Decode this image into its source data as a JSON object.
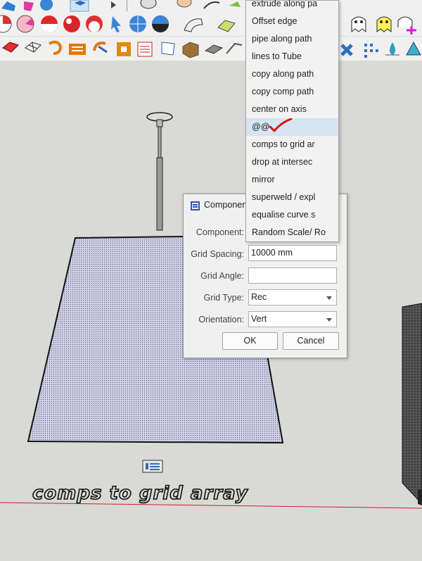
{
  "context_menu": {
    "items": [
      {
        "label": "extrude along pa"
      },
      {
        "label": "Offset edge"
      },
      {
        "label": "pipe along path"
      },
      {
        "label": "lines to Tube"
      },
      {
        "label": "copy along path"
      },
      {
        "label": "copy comp path"
      },
      {
        "label": "center on axis"
      },
      {
        "label": "@@"
      },
      {
        "label": "comps to grid ar"
      },
      {
        "label": "drop at intersec"
      },
      {
        "label": "mirror"
      },
      {
        "label": "superweld / expl"
      },
      {
        "label": "equalise curve s"
      },
      {
        "label": "Random Scale/ Ro"
      }
    ],
    "highlighted_index": 7
  },
  "dialog": {
    "title": "Componen",
    "fields": {
      "component": {
        "label": "Component:",
        "value": ""
      },
      "grid_spacing": {
        "label": "Grid Spacing:",
        "value": "10000 mm"
      },
      "grid_angle": {
        "label": "Grid Angle:",
        "value": ""
      },
      "grid_type": {
        "label": "Grid Type:",
        "value": "Rec"
      },
      "orientation": {
        "label": "Orientation:",
        "value": "Vert"
      }
    },
    "ok_label": "OK",
    "cancel_label": "Cancel"
  },
  "viewport": {
    "caption": "comps to grid array",
    "colors": {
      "background": "#d9d9d6",
      "plane_fill": "#c8c9e0",
      "red_axis": "#cc2222",
      "checkmark": "#dd1111"
    }
  },
  "toolbar": {
    "icons": [
      "ruby-plugin-icon",
      "speech-bubble-icon",
      "sphere-icon",
      "cube-icon",
      "dome-icon",
      "hand-icon",
      "curved-surface-icon",
      "leaf-icon",
      "ghost-icon",
      "ghost-outline-icon",
      "red-cube-icon",
      "wireframe-icon",
      "rotate-icon",
      "arc-icon",
      "square-icon",
      "list-icon",
      "flag-icon",
      "box-icon",
      "cylinder-icon",
      "line-icon",
      "gear-icon",
      "grid-icon",
      "water-drop-icon",
      "cone-icon"
    ]
  }
}
